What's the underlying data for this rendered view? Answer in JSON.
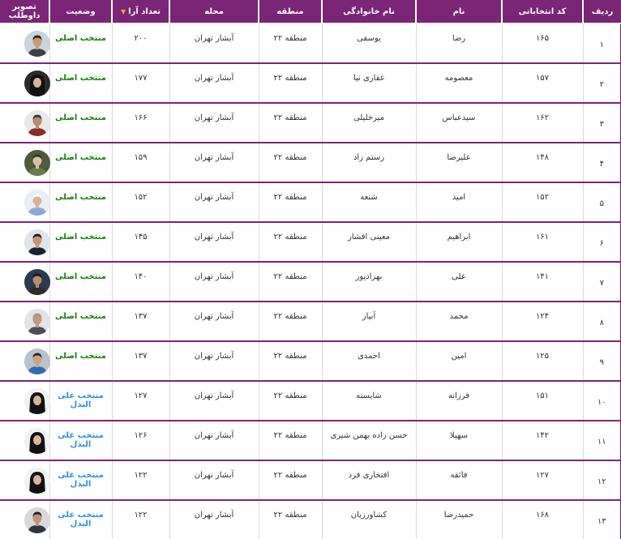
{
  "headers": {
    "row": "ردیف",
    "code": "کد انتخاباتی",
    "first": "نام",
    "last": "نام خانوادگی",
    "region": "منطقه",
    "area": "محله",
    "votes": "تعداد آرا",
    "status": "وضعیت",
    "photo": "تصویر داوطلب"
  },
  "sort_indicator": "▼",
  "status_colors": {
    "main": "#1e7d10",
    "alt": "#2c8ee0"
  },
  "header_color": "#7b2577",
  "rows": [
    {
      "row": "۱",
      "code": "۱۶۵",
      "first": "رضا",
      "last": "یوسفی",
      "region": "منطقه ۲۲",
      "area": "آبشار تهران",
      "votes": "۲۰۰",
      "status": "منتخب اصلی",
      "kind": "main",
      "photo": {
        "bg": "#c9d3dc",
        "skin": "#c89a7a",
        "hair": "#2a1e18",
        "body": "#3b3f47",
        "shape": "man"
      }
    },
    {
      "row": "۲",
      "code": "۱۵۷",
      "first": "معصومه",
      "last": "غفاری نیا",
      "region": "منطقه ۲۲",
      "area": "آبشار تهران",
      "votes": "۱۷۷",
      "status": "منتخب اصلی",
      "kind": "main",
      "photo": {
        "bg": "#2b2b2b",
        "skin": "#d8b49a",
        "hair": "#111111",
        "body": "#111111",
        "shape": "woman"
      }
    },
    {
      "row": "۳",
      "code": "۱۶۲",
      "first": "سیدعباس",
      "last": "میرخلیلی",
      "region": "منطقه ۲۲",
      "area": "آبشار تهران",
      "votes": "۱۶۶",
      "status": "منتخب اصلی",
      "kind": "main",
      "photo": {
        "bg": "#e8e8e8",
        "skin": "#b98a6c",
        "hair": "#3a3a3a",
        "body": "#8a2c2c",
        "shape": "man"
      }
    },
    {
      "row": "۴",
      "code": "۱۴۸",
      "first": "علیرضا",
      "last": "رستم زاد",
      "region": "منطقه ۲۲",
      "area": "آبشار تهران",
      "votes": "۱۵۹",
      "status": "منتخب اصلی",
      "kind": "main",
      "photo": {
        "bg": "#4d5b3a",
        "skin": "#d7c1a8",
        "hair": "#2f3a22",
        "body": "#6b7a4f",
        "shape": "man"
      }
    },
    {
      "row": "۵",
      "code": "۱۵۲",
      "first": "امید",
      "last": "شنعه",
      "region": "منطقه ۲۲",
      "area": "آبشار تهران",
      "votes": "۱۵۲",
      "status": "منتخب اصلی",
      "kind": "main",
      "photo": {
        "bg": "#e9eef5",
        "skin": "#d9b394",
        "hair": "#ffffff",
        "body": "#8fa9d6",
        "shape": "man"
      }
    },
    {
      "row": "۶",
      "code": "۱۶۱",
      "first": "ابراهیم",
      "last": "معینی افشار",
      "region": "منطقه ۲۲",
      "area": "آبشار تهران",
      "votes": "۱۴۵",
      "status": "منتخب اصلی",
      "kind": "main",
      "photo": {
        "bg": "#dfe4ea",
        "skin": "#c49476",
        "hair": "#1e1a18",
        "body": "#1d2230",
        "shape": "man"
      }
    },
    {
      "row": "۷",
      "code": "۱۴۱",
      "first": "علی",
      "last": "بهزادپور",
      "region": "منطقه ۲۲",
      "area": "آبشار تهران",
      "votes": "۱۴۰",
      "status": "منتخب اصلی",
      "kind": "main",
      "photo": {
        "bg": "#2c3a52",
        "skin": "#b88d70",
        "hair": "#1a1a1a",
        "body": "#2c2c2c",
        "shape": "man"
      }
    },
    {
      "row": "۸",
      "code": "۱۲۴",
      "first": "محمد",
      "last": "آبیار",
      "region": "منطقه ۲۲",
      "area": "آبشار تهران",
      "votes": "۱۳۷",
      "status": "منتخب اصلی",
      "kind": "main",
      "photo": {
        "bg": "#e3e3e3",
        "skin": "#c39a7e",
        "hair": "#9a9a9a",
        "body": "#4a4f59",
        "shape": "man"
      }
    },
    {
      "row": "۹",
      "code": "۱۲۵",
      "first": "امین",
      "last": "احمدی",
      "region": "منطقه ۲۲",
      "area": "آبشار تهران",
      "votes": "۱۳۷",
      "status": "منتخب اصلی",
      "kind": "main",
      "photo": {
        "bg": "#b8c3cf",
        "skin": "#c9a285",
        "hair": "#2a2520",
        "body": "#2f6db0",
        "shape": "man"
      }
    },
    {
      "row": "۱۰",
      "code": "۱۵۱",
      "first": "فرزانه",
      "last": "شایسته",
      "region": "منطقه ۲۲",
      "area": "آبشار تهران",
      "votes": "۱۲۷",
      "status": "منتخب علی البدل",
      "kind": "alt",
      "photo": {
        "bg": "#f2f2f2",
        "skin": "#d6b49b",
        "hair": "#111111",
        "body": "#111111",
        "shape": "woman"
      }
    },
    {
      "row": "۱۱",
      "code": "۱۴۲",
      "first": "سهیلا",
      "last": "حسن زاده بهمن شیری",
      "region": "منطقه ۲۲",
      "area": "آبشار تهران",
      "votes": "۱۲۶",
      "status": "منتخب علی البدل",
      "kind": "alt",
      "photo": {
        "bg": "#f2f2f2",
        "skin": "#d9b79c",
        "hair": "#111111",
        "body": "#111111",
        "shape": "woman"
      }
    },
    {
      "row": "۱۲",
      "code": "۱۲۷",
      "first": "فائقه",
      "last": "افتخاری فرد",
      "region": "منطقه ۲۲",
      "area": "آبشار تهران",
      "votes": "۱۲۲",
      "status": "منتخب علی البدل",
      "kind": "alt",
      "photo": {
        "bg": "#f2f2f2",
        "skin": "#d6b39a",
        "hair": "#111111",
        "body": "#111111",
        "shape": "woman"
      }
    },
    {
      "row": "۱۳",
      "code": "۱۶۸",
      "first": "حمیدرضا",
      "last": "کشاورزیان",
      "region": "منطقه ۲۲",
      "area": "آبشار تهران",
      "votes": "۱۲۲",
      "status": "منتخب علی البدل",
      "kind": "alt",
      "photo": {
        "bg": "#d9d9d9",
        "skin": "#c0937a",
        "hair": "#222222",
        "body": "#2e3440",
        "shape": "man"
      }
    }
  ]
}
